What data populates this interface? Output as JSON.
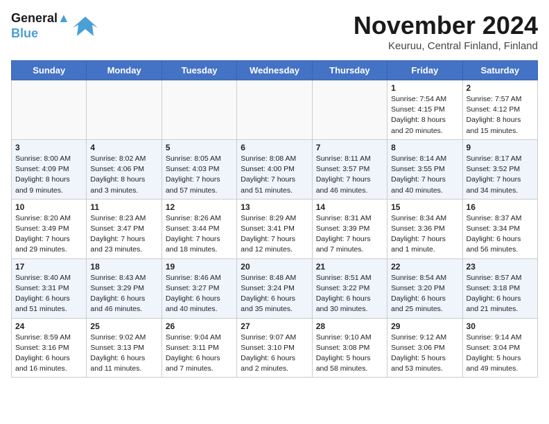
{
  "header": {
    "logo_line1": "General",
    "logo_line2": "Blue",
    "month_title": "November 2024",
    "subtitle": "Keuruu, Central Finland, Finland"
  },
  "weekdays": [
    "Sunday",
    "Monday",
    "Tuesday",
    "Wednesday",
    "Thursday",
    "Friday",
    "Saturday"
  ],
  "weeks": [
    [
      {
        "day": "",
        "info": ""
      },
      {
        "day": "",
        "info": ""
      },
      {
        "day": "",
        "info": ""
      },
      {
        "day": "",
        "info": ""
      },
      {
        "day": "",
        "info": ""
      },
      {
        "day": "1",
        "info": "Sunrise: 7:54 AM\nSunset: 4:15 PM\nDaylight: 8 hours and 20 minutes."
      },
      {
        "day": "2",
        "info": "Sunrise: 7:57 AM\nSunset: 4:12 PM\nDaylight: 8 hours and 15 minutes."
      }
    ],
    [
      {
        "day": "3",
        "info": "Sunrise: 8:00 AM\nSunset: 4:09 PM\nDaylight: 8 hours and 9 minutes."
      },
      {
        "day": "4",
        "info": "Sunrise: 8:02 AM\nSunset: 4:06 PM\nDaylight: 8 hours and 3 minutes."
      },
      {
        "day": "5",
        "info": "Sunrise: 8:05 AM\nSunset: 4:03 PM\nDaylight: 7 hours and 57 minutes."
      },
      {
        "day": "6",
        "info": "Sunrise: 8:08 AM\nSunset: 4:00 PM\nDaylight: 7 hours and 51 minutes."
      },
      {
        "day": "7",
        "info": "Sunrise: 8:11 AM\nSunset: 3:57 PM\nDaylight: 7 hours and 46 minutes."
      },
      {
        "day": "8",
        "info": "Sunrise: 8:14 AM\nSunset: 3:55 PM\nDaylight: 7 hours and 40 minutes."
      },
      {
        "day": "9",
        "info": "Sunrise: 8:17 AM\nSunset: 3:52 PM\nDaylight: 7 hours and 34 minutes."
      }
    ],
    [
      {
        "day": "10",
        "info": "Sunrise: 8:20 AM\nSunset: 3:49 PM\nDaylight: 7 hours and 29 minutes."
      },
      {
        "day": "11",
        "info": "Sunrise: 8:23 AM\nSunset: 3:47 PM\nDaylight: 7 hours and 23 minutes."
      },
      {
        "day": "12",
        "info": "Sunrise: 8:26 AM\nSunset: 3:44 PM\nDaylight: 7 hours and 18 minutes."
      },
      {
        "day": "13",
        "info": "Sunrise: 8:29 AM\nSunset: 3:41 PM\nDaylight: 7 hours and 12 minutes."
      },
      {
        "day": "14",
        "info": "Sunrise: 8:31 AM\nSunset: 3:39 PM\nDaylight: 7 hours and 7 minutes."
      },
      {
        "day": "15",
        "info": "Sunrise: 8:34 AM\nSunset: 3:36 PM\nDaylight: 7 hours and 1 minute."
      },
      {
        "day": "16",
        "info": "Sunrise: 8:37 AM\nSunset: 3:34 PM\nDaylight: 6 hours and 56 minutes."
      }
    ],
    [
      {
        "day": "17",
        "info": "Sunrise: 8:40 AM\nSunset: 3:31 PM\nDaylight: 6 hours and 51 minutes."
      },
      {
        "day": "18",
        "info": "Sunrise: 8:43 AM\nSunset: 3:29 PM\nDaylight: 6 hours and 46 minutes."
      },
      {
        "day": "19",
        "info": "Sunrise: 8:46 AM\nSunset: 3:27 PM\nDaylight: 6 hours and 40 minutes."
      },
      {
        "day": "20",
        "info": "Sunrise: 8:48 AM\nSunset: 3:24 PM\nDaylight: 6 hours and 35 minutes."
      },
      {
        "day": "21",
        "info": "Sunrise: 8:51 AM\nSunset: 3:22 PM\nDaylight: 6 hours and 30 minutes."
      },
      {
        "day": "22",
        "info": "Sunrise: 8:54 AM\nSunset: 3:20 PM\nDaylight: 6 hours and 25 minutes."
      },
      {
        "day": "23",
        "info": "Sunrise: 8:57 AM\nSunset: 3:18 PM\nDaylight: 6 hours and 21 minutes."
      }
    ],
    [
      {
        "day": "24",
        "info": "Sunrise: 8:59 AM\nSunset: 3:16 PM\nDaylight: 6 hours and 16 minutes."
      },
      {
        "day": "25",
        "info": "Sunrise: 9:02 AM\nSunset: 3:13 PM\nDaylight: 6 hours and 11 minutes."
      },
      {
        "day": "26",
        "info": "Sunrise: 9:04 AM\nSunset: 3:11 PM\nDaylight: 6 hours and 7 minutes."
      },
      {
        "day": "27",
        "info": "Sunrise: 9:07 AM\nSunset: 3:10 PM\nDaylight: 6 hours and 2 minutes."
      },
      {
        "day": "28",
        "info": "Sunrise: 9:10 AM\nSunset: 3:08 PM\nDaylight: 5 hours and 58 minutes."
      },
      {
        "day": "29",
        "info": "Sunrise: 9:12 AM\nSunset: 3:06 PM\nDaylight: 5 hours and 53 minutes."
      },
      {
        "day": "30",
        "info": "Sunrise: 9:14 AM\nSunset: 3:04 PM\nDaylight: 5 hours and 49 minutes."
      }
    ]
  ]
}
